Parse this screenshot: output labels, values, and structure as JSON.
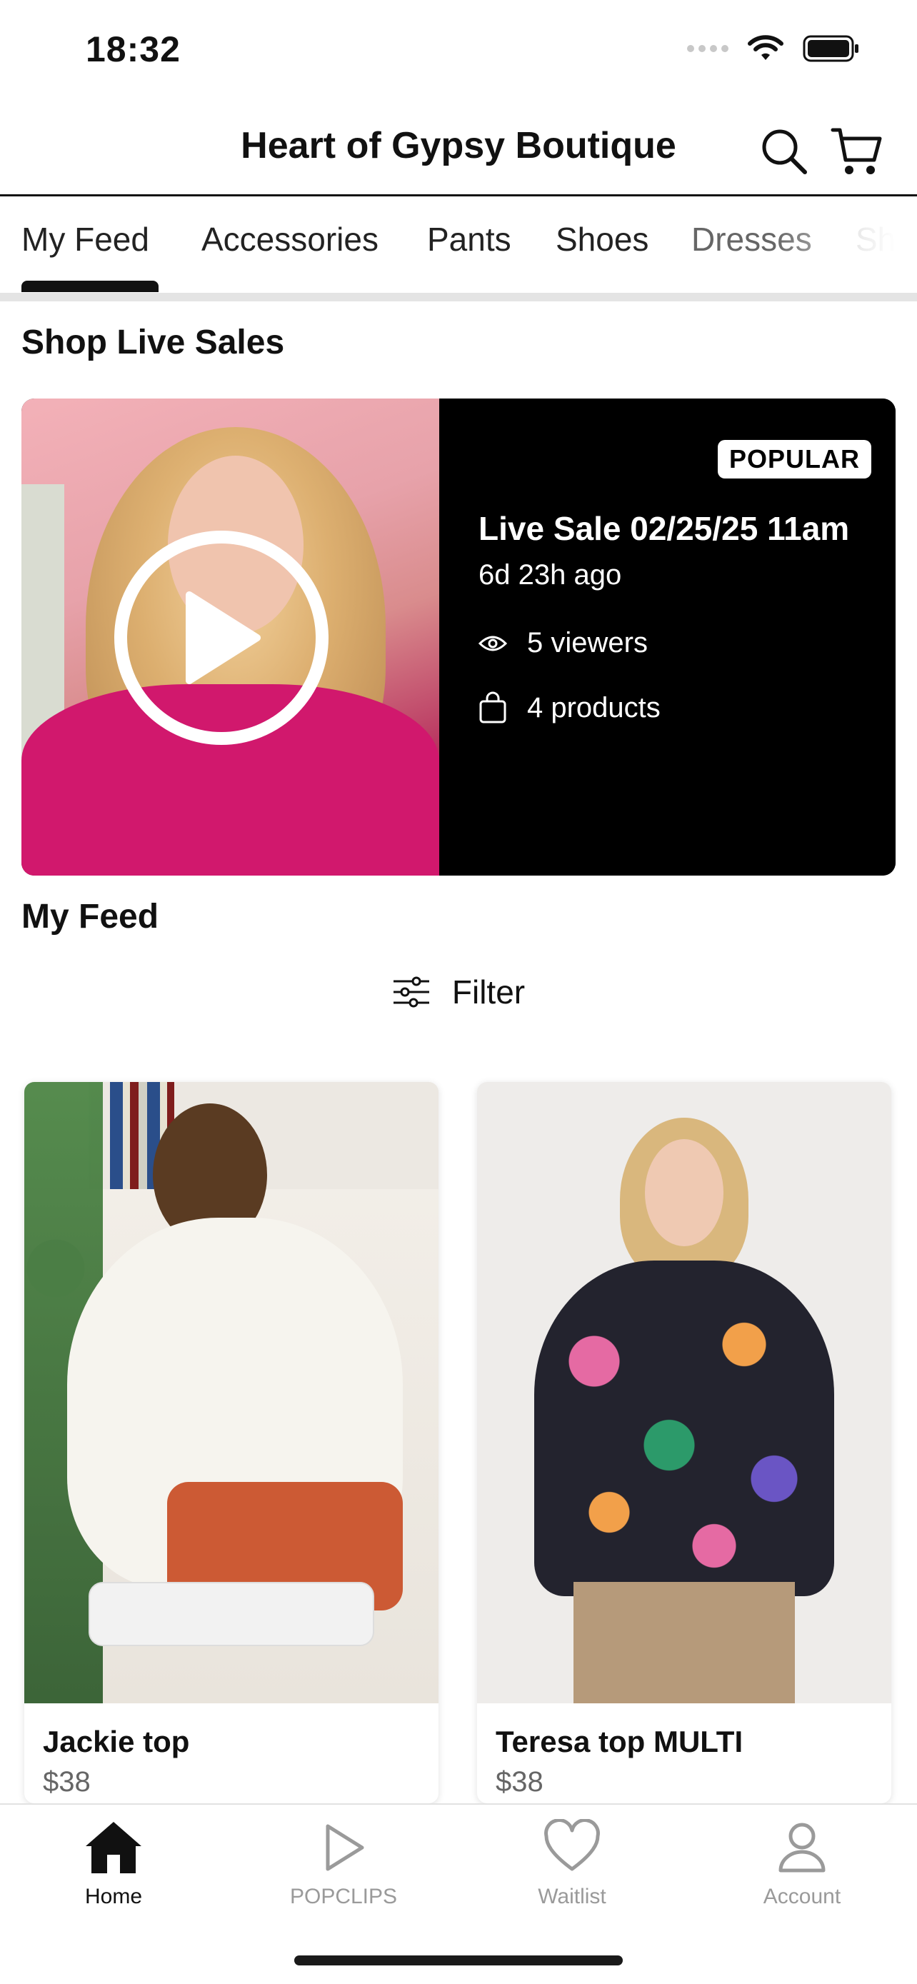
{
  "status_bar": {
    "time": "18:32"
  },
  "header": {
    "title": "Heart of Gypsy Boutique"
  },
  "tabs": [
    {
      "label": "My Feed",
      "active": true
    },
    {
      "label": "Accessories"
    },
    {
      "label": "Pants"
    },
    {
      "label": "Shoes"
    },
    {
      "label": "Dresses"
    },
    {
      "label": "Sh"
    }
  ],
  "live_section": {
    "title": "Shop Live Sales",
    "card": {
      "badge": "POPULAR",
      "title": "Live Sale 02/25/25 11am",
      "time_ago": "6d 23h ago",
      "viewers": "5 viewers",
      "products": "4 products"
    }
  },
  "feed": {
    "title": "My Feed",
    "filter_label": "Filter",
    "products": [
      {
        "name": "Jackie top",
        "price": "$38"
      },
      {
        "name": "Teresa top MULTI",
        "price": "$38"
      }
    ]
  },
  "bottom_nav": [
    {
      "label": "Home",
      "icon": "home-icon",
      "active": true
    },
    {
      "label": "POPCLIPS",
      "icon": "play-icon"
    },
    {
      "label": "Waitlist",
      "icon": "heart-icon"
    },
    {
      "label": "Account",
      "icon": "person-icon"
    }
  ]
}
